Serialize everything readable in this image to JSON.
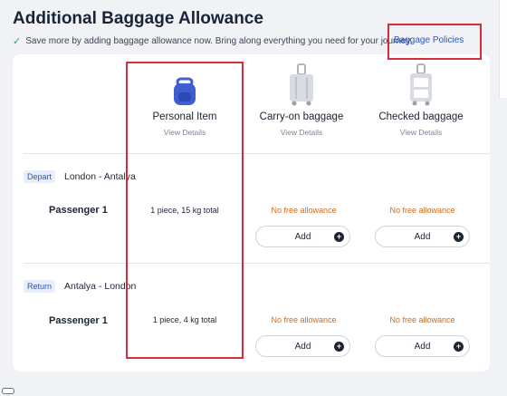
{
  "page": {
    "title": "Additional Baggage Allowance",
    "subtitle": "Save more by adding baggage allowance now. Bring along everything you need for your journey.",
    "policy_link": "Baggage Policies"
  },
  "columns": [
    {
      "label": "Personal Item",
      "details": "View Details",
      "icon": "backpack-icon"
    },
    {
      "label": "Carry-on baggage",
      "details": "View Details",
      "icon": "carry-on-suitcase-icon"
    },
    {
      "label": "Checked baggage",
      "details": "View Details",
      "icon": "checked-suitcase-icon"
    }
  ],
  "segments": [
    {
      "badge": "Depart",
      "route": "London - Antalya",
      "passenger": "Passenger 1",
      "personal_item": "1 piece, 15 kg total",
      "carry_on": "No free allowance",
      "checked": "No free allowance",
      "add_label": "Add"
    },
    {
      "badge": "Return",
      "route": "Antalya - London",
      "passenger": "Passenger 1",
      "personal_item": "1 piece, 4 kg total",
      "carry_on": "No free allowance",
      "checked": "No free allowance",
      "add_label": "Add"
    }
  ],
  "colors": {
    "accent_link": "#2f56b8",
    "no_allowance": "#d06a1c",
    "highlight_box": "#d22f3c",
    "check": "#2f9e6a",
    "backpack": "#3f5fd1"
  }
}
